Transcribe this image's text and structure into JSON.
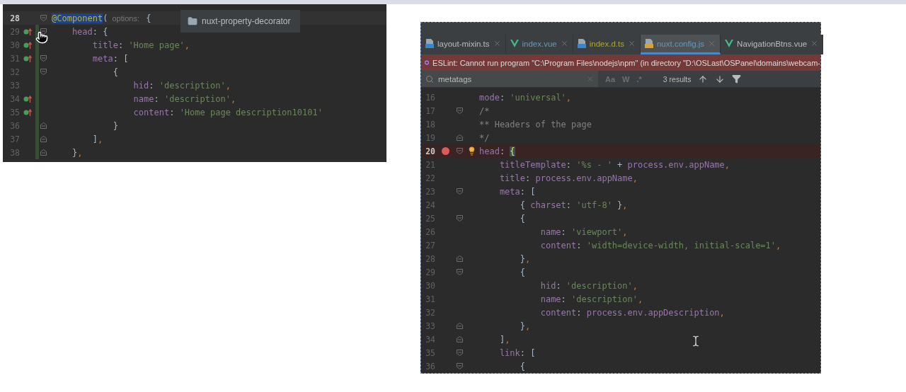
{
  "left_editor": {
    "tooltip": {
      "label": "nuxt-property-decorator"
    },
    "lines": [
      {
        "n": "28",
        "fold_start": true,
        "fold_end": false,
        "override": false,
        "changed": false,
        "current": true,
        "t": [
          {
            "kind": "sel",
            "text": "@Component"
          },
          {
            "kind": "punct",
            "text": "("
          },
          {
            "kind": "hint",
            "text": "options:"
          },
          {
            "kind": "punct",
            "text": " {"
          }
        ]
      },
      {
        "n": "29",
        "fold_start": true,
        "fold_end": false,
        "override": true,
        "changed": true,
        "current": false,
        "t": [
          {
            "kind": "key",
            "text": "    head"
          },
          {
            "kind": "punct",
            "text": ": {"
          }
        ]
      },
      {
        "n": "30",
        "fold_start": false,
        "fold_end": false,
        "override": true,
        "changed": true,
        "current": false,
        "t": [
          {
            "kind": "key",
            "text": "        title"
          },
          {
            "kind": "punct",
            "text": ": "
          },
          {
            "kind": "str",
            "text": "'Home page'"
          },
          {
            "kind": "comma",
            "text": ","
          }
        ]
      },
      {
        "n": "31",
        "fold_start": true,
        "fold_end": false,
        "override": true,
        "changed": true,
        "current": false,
        "t": [
          {
            "kind": "key",
            "text": "        meta"
          },
          {
            "kind": "punct",
            "text": ": ["
          }
        ]
      },
      {
        "n": "32",
        "fold_start": true,
        "fold_end": false,
        "override": false,
        "changed": true,
        "current": false,
        "t": [
          {
            "kind": "punct",
            "text": "            {"
          }
        ]
      },
      {
        "n": "33",
        "fold_start": false,
        "fold_end": false,
        "override": false,
        "changed": true,
        "current": false,
        "t": [
          {
            "kind": "key",
            "text": "                hid"
          },
          {
            "kind": "punct",
            "text": ": "
          },
          {
            "kind": "str",
            "text": "'description'"
          },
          {
            "kind": "comma",
            "text": ","
          }
        ]
      },
      {
        "n": "34",
        "fold_start": false,
        "fold_end": false,
        "override": true,
        "changed": true,
        "current": false,
        "t": [
          {
            "kind": "key",
            "text": "                name"
          },
          {
            "kind": "punct",
            "text": ": "
          },
          {
            "kind": "str",
            "text": "'description'"
          },
          {
            "kind": "comma",
            "text": ","
          }
        ]
      },
      {
        "n": "35",
        "fold_start": false,
        "fold_end": false,
        "override": true,
        "changed": true,
        "current": false,
        "t": [
          {
            "kind": "key",
            "text": "                content"
          },
          {
            "kind": "punct",
            "text": ": "
          },
          {
            "kind": "str",
            "text": "'Home page description10101'"
          }
        ]
      },
      {
        "n": "36",
        "fold_start": false,
        "fold_end": true,
        "override": false,
        "changed": true,
        "current": false,
        "t": [
          {
            "kind": "punct",
            "text": "            }"
          }
        ]
      },
      {
        "n": "37",
        "fold_start": false,
        "fold_end": true,
        "override": false,
        "changed": true,
        "current": false,
        "t": [
          {
            "kind": "punct",
            "text": "        ]"
          },
          {
            "kind": "comma",
            "text": ","
          }
        ]
      },
      {
        "n": "38",
        "fold_start": false,
        "fold_end": true,
        "override": false,
        "changed": true,
        "current": false,
        "t": [
          {
            "kind": "punct",
            "text": "    }"
          },
          {
            "kind": "comma",
            "text": ","
          }
        ]
      }
    ]
  },
  "right_editor": {
    "tabs": [
      {
        "label": "layout-mixin.ts",
        "kind": "ts",
        "color": "#bbbbbb",
        "selected": false
      },
      {
        "label": "index.vue",
        "kind": "vue",
        "color": "#6897bb",
        "selected": false
      },
      {
        "label": "index.d.ts",
        "kind": "ts",
        "color": "#a8a838",
        "selected": false
      },
      {
        "label": "nuxt.config.js",
        "kind": "js",
        "color": "#6897bb",
        "selected": true
      },
      {
        "label": "NavigationBtns.vue",
        "kind": "vue",
        "color": "#bbbbbb",
        "selected": false
      }
    ],
    "error_banner": "ESLint: Cannot run program \"C:\\Program Files\\nodejs\\npm\" (in directory \"D:\\OSLast\\OSPanel\\domains\\webcam-",
    "search": {
      "value": "metatags",
      "options": [
        "Aa",
        "W",
        ".*"
      ],
      "results": "3 results"
    },
    "lines": [
      {
        "n": "16",
        "fold_start": false,
        "fold_end": false,
        "breakpoint": false,
        "current": false,
        "t": [
          {
            "kind": "key",
            "text": "mode"
          },
          {
            "kind": "punct",
            "text": ": "
          },
          {
            "kind": "str",
            "text": "'universal'"
          },
          {
            "kind": "comma",
            "text": ","
          }
        ]
      },
      {
        "n": "17",
        "fold_start": true,
        "fold_end": false,
        "breakpoint": false,
        "current": false,
        "t": [
          {
            "kind": "comment",
            "text": "/*"
          }
        ]
      },
      {
        "n": "18",
        "fold_start": false,
        "fold_end": false,
        "breakpoint": false,
        "current": false,
        "t": [
          {
            "kind": "comment",
            "text": "** Headers of the page"
          }
        ]
      },
      {
        "n": "19",
        "fold_start": false,
        "fold_end": true,
        "breakpoint": false,
        "current": false,
        "t": [
          {
            "kind": "comment",
            "text": "*/"
          }
        ]
      },
      {
        "n": "20",
        "fold_start": true,
        "fold_end": false,
        "breakpoint": true,
        "current": true,
        "t": [
          {
            "kind": "key",
            "text": "head"
          },
          {
            "kind": "punct",
            "text": ": "
          },
          {
            "kind": "brace",
            "text": "{"
          }
        ]
      },
      {
        "n": "21",
        "fold_start": false,
        "fold_end": false,
        "breakpoint": false,
        "current": false,
        "t": [
          {
            "kind": "key",
            "text": "    titleTemplate"
          },
          {
            "kind": "punct",
            "text": ": "
          },
          {
            "kind": "str",
            "text": "'%s - '"
          },
          {
            "kind": "punct",
            "text": " + "
          },
          {
            "kind": "key",
            "text": "process.env.appName"
          },
          {
            "kind": "comma",
            "text": ","
          }
        ]
      },
      {
        "n": "22",
        "fold_start": false,
        "fold_end": false,
        "breakpoint": false,
        "current": false,
        "t": [
          {
            "kind": "key",
            "text": "    title"
          },
          {
            "kind": "punct",
            "text": ": "
          },
          {
            "kind": "key",
            "text": "process.env.appName"
          },
          {
            "kind": "comma",
            "text": ","
          }
        ]
      },
      {
        "n": "23",
        "fold_start": true,
        "fold_end": false,
        "breakpoint": false,
        "current": false,
        "t": [
          {
            "kind": "key",
            "text": "    meta"
          },
          {
            "kind": "punct",
            "text": ": ["
          }
        ]
      },
      {
        "n": "24",
        "fold_start": false,
        "fold_end": false,
        "breakpoint": false,
        "current": false,
        "t": [
          {
            "kind": "punct",
            "text": "        { "
          },
          {
            "kind": "key",
            "text": "charset"
          },
          {
            "kind": "punct",
            "text": ": "
          },
          {
            "kind": "str",
            "text": "'utf-8'"
          },
          {
            "kind": "punct",
            "text": " }"
          },
          {
            "kind": "comma",
            "text": ","
          }
        ]
      },
      {
        "n": "25",
        "fold_start": true,
        "fold_end": false,
        "breakpoint": false,
        "current": false,
        "t": [
          {
            "kind": "punct",
            "text": "        {"
          }
        ]
      },
      {
        "n": "26",
        "fold_start": false,
        "fold_end": false,
        "breakpoint": false,
        "current": false,
        "t": [
          {
            "kind": "key",
            "text": "            name"
          },
          {
            "kind": "punct",
            "text": ": "
          },
          {
            "kind": "str",
            "text": "'viewport'"
          },
          {
            "kind": "comma",
            "text": ","
          }
        ]
      },
      {
        "n": "27",
        "fold_start": false,
        "fold_end": false,
        "breakpoint": false,
        "current": false,
        "t": [
          {
            "kind": "key",
            "text": "            content"
          },
          {
            "kind": "punct",
            "text": ": "
          },
          {
            "kind": "str",
            "text": "'width=device-width, initial-scale=1'"
          },
          {
            "kind": "comma",
            "text": ","
          }
        ]
      },
      {
        "n": "28",
        "fold_start": false,
        "fold_end": true,
        "breakpoint": false,
        "current": false,
        "t": [
          {
            "kind": "punct",
            "text": "        }"
          },
          {
            "kind": "comma",
            "text": ","
          }
        ]
      },
      {
        "n": "29",
        "fold_start": true,
        "fold_end": false,
        "breakpoint": false,
        "current": false,
        "t": [
          {
            "kind": "punct",
            "text": "        {"
          }
        ]
      },
      {
        "n": "30",
        "fold_start": false,
        "fold_end": false,
        "breakpoint": false,
        "current": false,
        "t": [
          {
            "kind": "key",
            "text": "            hid"
          },
          {
            "kind": "punct",
            "text": ": "
          },
          {
            "kind": "str",
            "text": "'description'"
          },
          {
            "kind": "comma",
            "text": ","
          }
        ]
      },
      {
        "n": "31",
        "fold_start": false,
        "fold_end": false,
        "breakpoint": false,
        "current": false,
        "t": [
          {
            "kind": "key",
            "text": "            name"
          },
          {
            "kind": "punct",
            "text": ": "
          },
          {
            "kind": "str",
            "text": "'description'"
          },
          {
            "kind": "comma",
            "text": ","
          }
        ]
      },
      {
        "n": "32",
        "fold_start": false,
        "fold_end": false,
        "breakpoint": false,
        "current": false,
        "t": [
          {
            "kind": "key",
            "text": "            content"
          },
          {
            "kind": "punct",
            "text": ": "
          },
          {
            "kind": "key",
            "text": "process.env.appDescription"
          },
          {
            "kind": "comma",
            "text": ","
          }
        ]
      },
      {
        "n": "33",
        "fold_start": false,
        "fold_end": true,
        "breakpoint": false,
        "current": false,
        "t": [
          {
            "kind": "punct",
            "text": "        }"
          },
          {
            "kind": "comma",
            "text": ","
          }
        ]
      },
      {
        "n": "34",
        "fold_start": false,
        "fold_end": true,
        "breakpoint": false,
        "current": false,
        "t": [
          {
            "kind": "punct",
            "text": "    ]"
          },
          {
            "kind": "comma",
            "text": ","
          }
        ]
      },
      {
        "n": "35",
        "fold_start": true,
        "fold_end": false,
        "breakpoint": false,
        "current": false,
        "t": [
          {
            "kind": "key",
            "text": "    link"
          },
          {
            "kind": "punct",
            "text": ": ["
          }
        ]
      },
      {
        "n": "36",
        "fold_start": true,
        "fold_end": false,
        "breakpoint": false,
        "current": false,
        "t": [
          {
            "kind": "punct",
            "text": "        {"
          }
        ]
      }
    ]
  }
}
